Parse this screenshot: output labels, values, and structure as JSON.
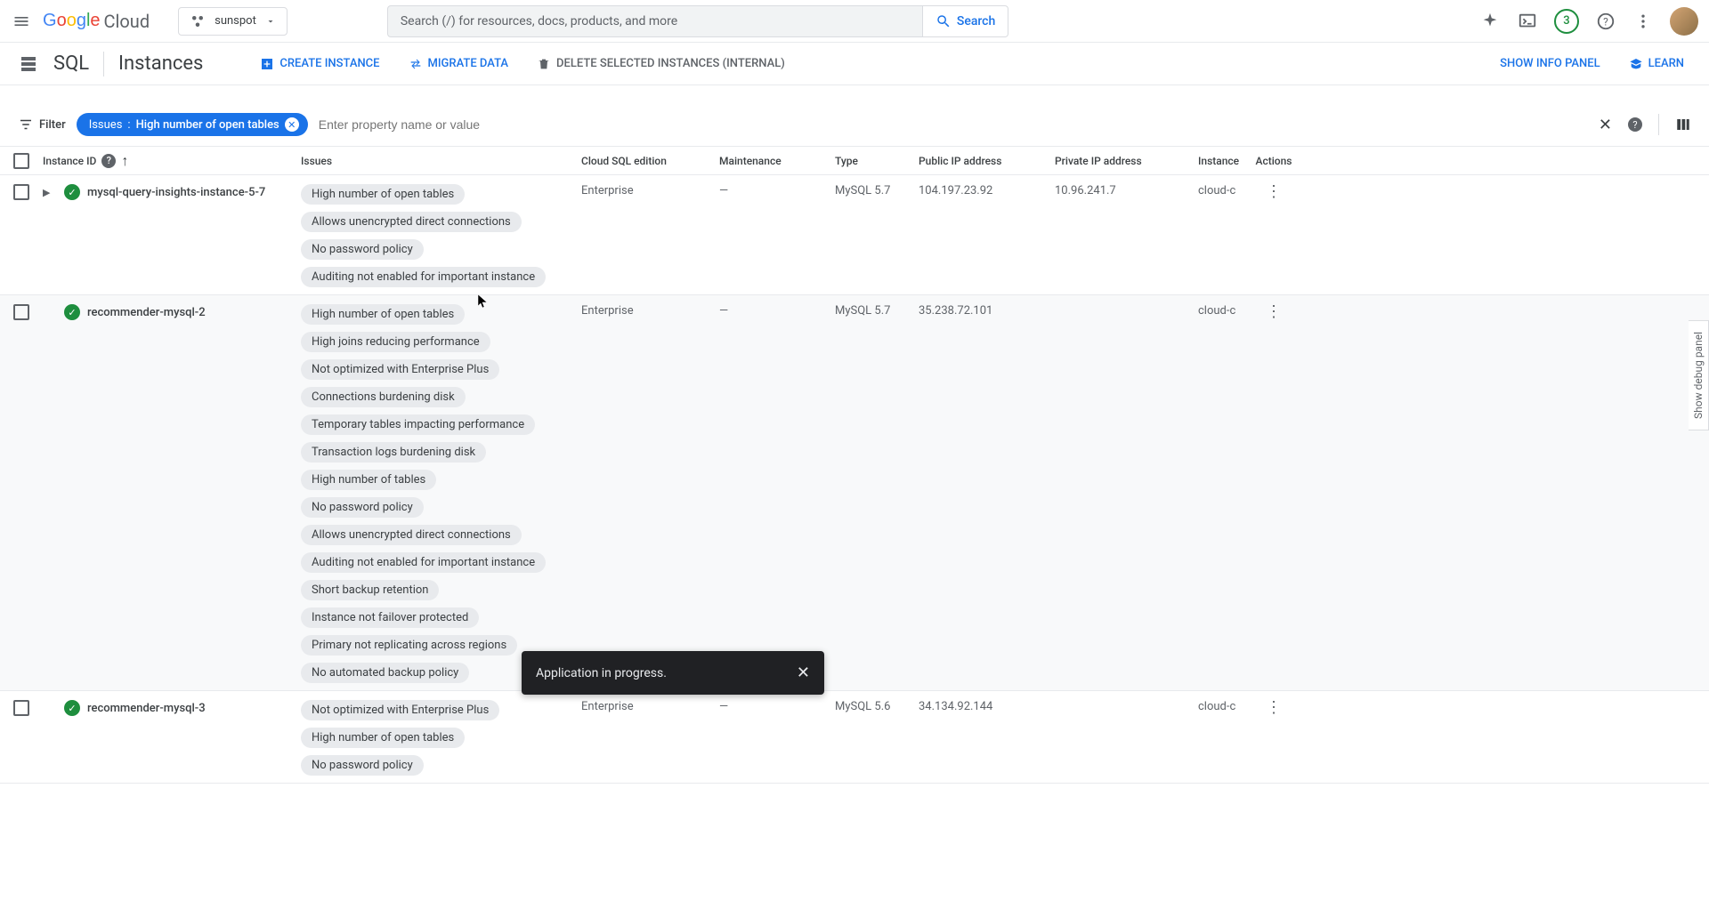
{
  "header": {
    "logo_text": "Google Cloud",
    "project_name": "sunspot",
    "search_placeholder": "Search (/) for resources, docs, products, and more",
    "search_button": "Search",
    "notification_count": "3"
  },
  "subheader": {
    "product": "SQL",
    "page": "Instances",
    "create": "CREATE INSTANCE",
    "migrate": "MIGRATE DATA",
    "delete": "DELETE SELECTED INSTANCES (INTERNAL)",
    "info_panel": "SHOW INFO PANEL",
    "learn": "LEARN"
  },
  "filter": {
    "label": "Filter",
    "chip_key": "Issues",
    "chip_sep": " : ",
    "chip_value": "High number of open tables",
    "placeholder": "Enter property name or value"
  },
  "columns": {
    "id": "Instance ID",
    "issues": "Issues",
    "edition": "Cloud SQL edition",
    "maintenance": "Maintenance",
    "type": "Type",
    "public_ip": "Public IP address",
    "private_ip": "Private IP address",
    "instance_col": "Instance",
    "actions": "Actions"
  },
  "rows": [
    {
      "id": "mysql-query-insights-instance-5-7",
      "expandable": true,
      "issues": [
        "High number of open tables",
        "Allows unencrypted direct connections",
        "No password policy",
        "Auditing not enabled for important instance"
      ],
      "edition": "Enterprise",
      "maintenance": "—",
      "type": "MySQL 5.7",
      "public_ip": "104.197.23.92",
      "private_ip": "10.96.241.7",
      "instance_col": "cloud-c"
    },
    {
      "id": "recommender-mysql-2",
      "expandable": false,
      "issues": [
        "High number of open tables",
        "High joins reducing performance",
        "Not optimized with Enterprise Plus",
        "Connections burdening disk",
        "Temporary tables impacting performance",
        "Transaction logs burdening disk",
        "High number of tables",
        "No password policy",
        "Allows unencrypted direct connections",
        "Auditing not enabled for important instance",
        "Short backup retention",
        "Instance not failover protected",
        "Primary not replicating across regions",
        "No automated backup policy"
      ],
      "edition": "Enterprise",
      "maintenance": "—",
      "type": "MySQL 5.7",
      "public_ip": "35.238.72.101",
      "private_ip": "",
      "instance_col": "cloud-c"
    },
    {
      "id": "recommender-mysql-3",
      "expandable": false,
      "issues": [
        "Not optimized with Enterprise Plus",
        "High number of open tables",
        "No password policy"
      ],
      "edition": "Enterprise",
      "maintenance": "—",
      "type": "MySQL 5.6",
      "public_ip": "34.134.92.144",
      "private_ip": "",
      "instance_col": "cloud-c"
    }
  ],
  "toast": {
    "message": "Application in progress."
  },
  "side_tab": "Show debug panel"
}
